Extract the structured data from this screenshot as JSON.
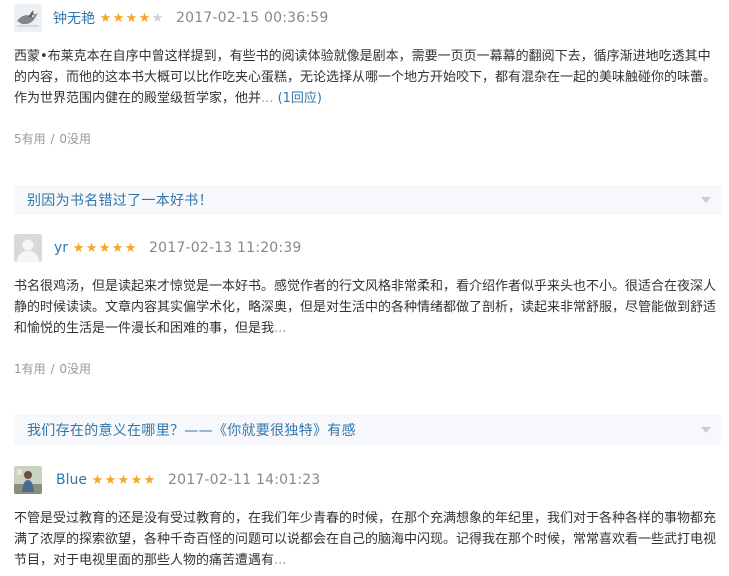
{
  "reviews": [
    {
      "author": "钟无艳",
      "rating": 4,
      "rating_max": 5,
      "date": "2017-02-15 00:36:59",
      "avatar_icon": "bird-avatar-icon",
      "body": "西蒙•布莱克本在自序中曾这样提到，有些书的阅读体验就像是剧本，需要一页页一幕幕的翻阅下去，循序渐进地吃透其中的内容，而他的这本书大概可以比作吃夹心蛋糕，无论选择从哪一个地方开始咬下，都有混杂在一起的美味触碰你的味蕾。 作为世界范围内健在的殿堂级哲学家，他并",
      "more": "...",
      "reply": "(1回应)",
      "useful": "5有用",
      "useless": "0没用"
    },
    {
      "author": "yr",
      "rating": 5,
      "rating_max": 5,
      "date": "2017-02-13 11:20:39",
      "avatar_icon": "default-avatar-icon",
      "body": "书名很鸡汤，但是读起来才惊觉是一本好书。感觉作者的行文风格非常柔和，看介绍作者似乎来头也不小。很适合在夜深人静的时候读读。文章内容其实偏学术化，略深奥，但是对生活中的各种情绪都做了剖析，读起来非常舒服，尽管能做到舒适和愉悦的生活是一件漫长和困难的事，但是我",
      "more": "...",
      "reply": "",
      "useful": "1有用",
      "useless": "0没用"
    },
    {
      "author": "Blue",
      "rating": 5,
      "rating_max": 5,
      "date": "2017-02-11 14:01:23",
      "avatar_icon": "photo-avatar-icon",
      "body": "不管是受过教育的还是没有受过教育的，在我们年少青春的时候，在那个充满想象的年纪里，我们对于各种各样的事物都充满了浓厚的探索欲望，各种千奇百怪的问题可以说都会在自己的脑海中闪现。记得我在那个时候，常常喜欢看一些武打电视节目，对于电视里面的那些人物的痛苦遭遇有",
      "more": "...",
      "reply": "",
      "useful": "",
      "useless": ""
    }
  ],
  "topics": [
    {
      "title": "别因为书名错过了一本好书！"
    },
    {
      "title": "我们存在的意义在哪里？——《你就要很独特》有感"
    }
  ],
  "vote_separator": " / ",
  "colors": {
    "link": "#3377aa",
    "star": "#f5a623",
    "topic_bg": "#f6f8fb",
    "meta": "#999999"
  }
}
